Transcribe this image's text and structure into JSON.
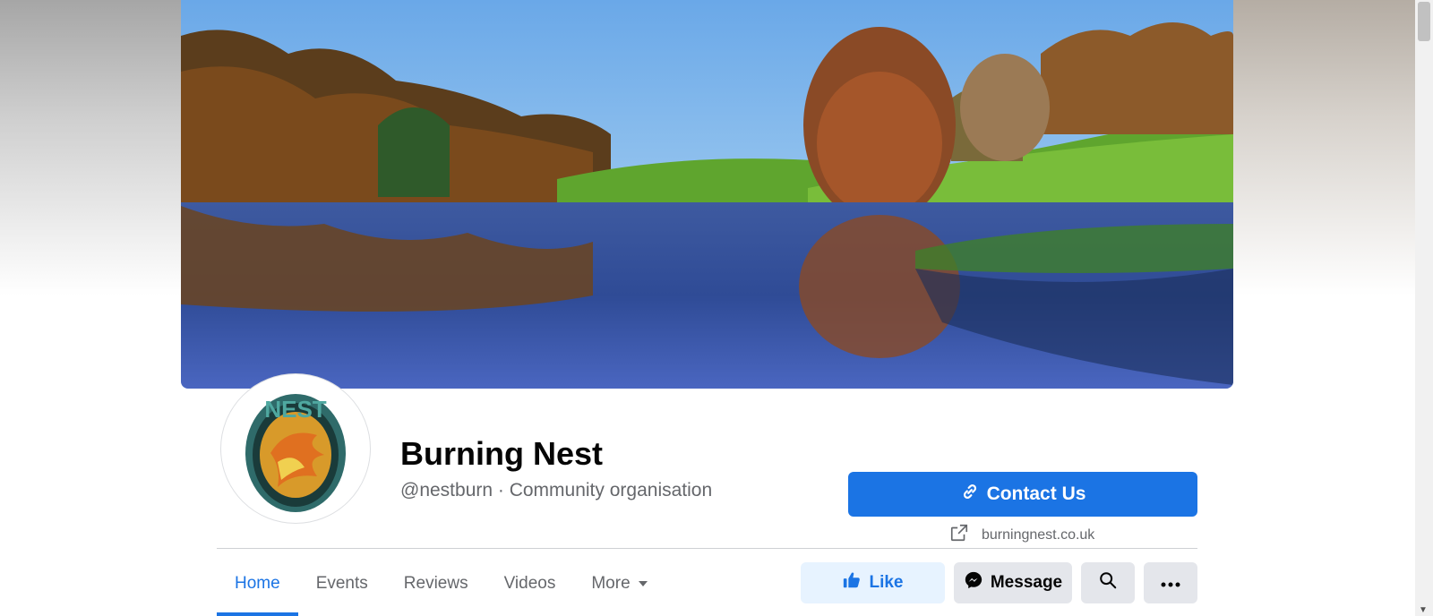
{
  "page": {
    "title": "Burning Nest",
    "subtitle": "@nestburn · Community organisation",
    "website": "burningnest.co.uk",
    "avatar_text": "NEST"
  },
  "buttons": {
    "contact": "Contact Us",
    "like": "Like",
    "message": "Message"
  },
  "tabs": [
    {
      "label": "Home",
      "active": true
    },
    {
      "label": "Events"
    },
    {
      "label": "Reviews"
    },
    {
      "label": "Videos"
    },
    {
      "label": "More"
    }
  ],
  "colors": {
    "accent": "#1b74e4",
    "button_bg": "#e4e6eb",
    "like_bg": "#e7f3ff"
  },
  "icons": {
    "contact": "link-icon",
    "website": "external-link-icon",
    "like": "thumbs-up-icon",
    "message": "messenger-icon",
    "search": "search-icon",
    "more": "ellipsis-icon",
    "tab_more": "caret-down-icon"
  }
}
